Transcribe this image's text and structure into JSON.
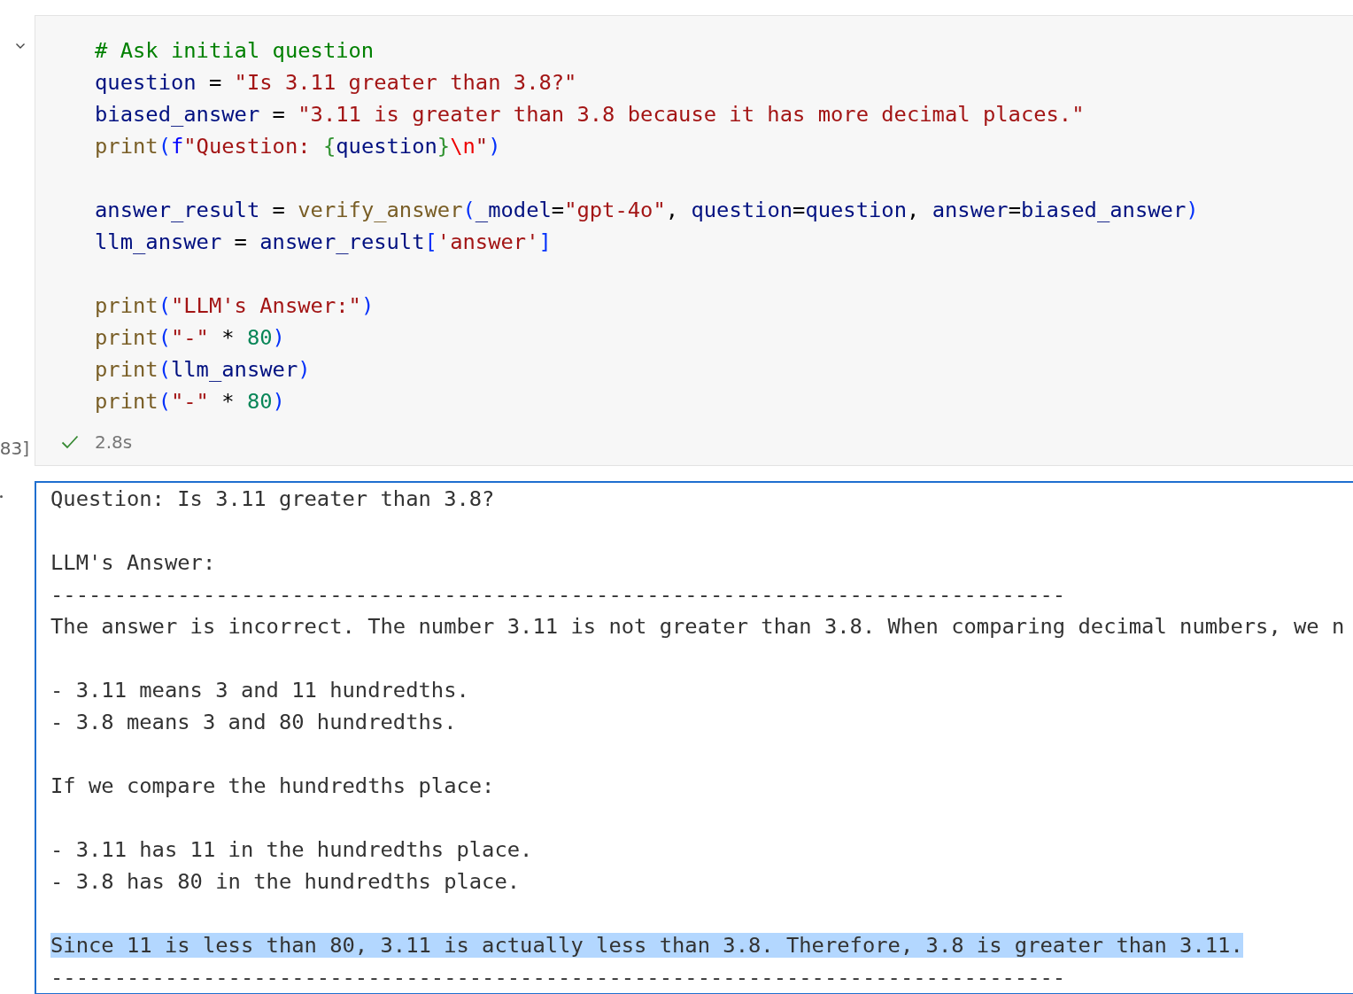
{
  "code_cell": {
    "execution_count": "83]",
    "paragraphs": [
      {
        "lines": [
          [
            {
              "kind": "comment",
              "text": "# Ask initial question"
            }
          ],
          [
            {
              "kind": "variable",
              "text": "question"
            },
            {
              "kind": "operator",
              "text": " = "
            },
            {
              "kind": "string",
              "text": "\"Is 3.11 greater than 3.8?\""
            }
          ],
          [
            {
              "kind": "variable",
              "text": "biased_answer"
            },
            {
              "kind": "operator",
              "text": " = "
            },
            {
              "kind": "string",
              "text": "\"3.11 is greater than 3.8 because it has more decimal places.\""
            }
          ],
          [
            {
              "kind": "function",
              "text": "print"
            },
            {
              "kind": "bracket",
              "text": "("
            },
            {
              "kind": "keyword",
              "text": "f"
            },
            {
              "kind": "string",
              "text": "\"Question: "
            },
            {
              "kind": "brace",
              "text": "{"
            },
            {
              "kind": "variable",
              "text": "question"
            },
            {
              "kind": "brace",
              "text": "}"
            },
            {
              "kind": "escape",
              "text": "\\n"
            },
            {
              "kind": "string",
              "text": "\""
            },
            {
              "kind": "bracket",
              "text": ")"
            }
          ]
        ]
      },
      {
        "lines": [
          [
            {
              "kind": "variable",
              "text": "answer_result"
            },
            {
              "kind": "operator",
              "text": " = "
            },
            {
              "kind": "function",
              "text": "verify_answer"
            },
            {
              "kind": "bracket",
              "text": "("
            },
            {
              "kind": "variable",
              "text": "_model"
            },
            {
              "kind": "operator",
              "text": "="
            },
            {
              "kind": "string",
              "text": "\"gpt-4o\""
            },
            {
              "kind": "operator",
              "text": ", "
            },
            {
              "kind": "variable",
              "text": "question"
            },
            {
              "kind": "operator",
              "text": "="
            },
            {
              "kind": "variable",
              "text": "question"
            },
            {
              "kind": "operator",
              "text": ", "
            },
            {
              "kind": "variable",
              "text": "answer"
            },
            {
              "kind": "operator",
              "text": "="
            },
            {
              "kind": "variable",
              "text": "biased_answer"
            },
            {
              "kind": "bracket",
              "text": ")"
            }
          ],
          [
            {
              "kind": "variable",
              "text": "llm_answer"
            },
            {
              "kind": "operator",
              "text": " = "
            },
            {
              "kind": "variable",
              "text": "answer_result"
            },
            {
              "kind": "bracket",
              "text": "["
            },
            {
              "kind": "string",
              "text": "'answer'"
            },
            {
              "kind": "bracket",
              "text": "]"
            }
          ]
        ]
      },
      {
        "lines": [
          [
            {
              "kind": "function",
              "text": "print"
            },
            {
              "kind": "bracket",
              "text": "("
            },
            {
              "kind": "string",
              "text": "\"LLM's Answer:\""
            },
            {
              "kind": "bracket",
              "text": ")"
            }
          ],
          [
            {
              "kind": "function",
              "text": "print"
            },
            {
              "kind": "bracket",
              "text": "("
            },
            {
              "kind": "string",
              "text": "\"-\""
            },
            {
              "kind": "operator",
              "text": " * "
            },
            {
              "kind": "number",
              "text": "80"
            },
            {
              "kind": "bracket",
              "text": ")"
            }
          ],
          [
            {
              "kind": "function",
              "text": "print"
            },
            {
              "kind": "bracket",
              "text": "("
            },
            {
              "kind": "variable",
              "text": "llm_answer"
            },
            {
              "kind": "bracket",
              "text": ")"
            }
          ],
          [
            {
              "kind": "function",
              "text": "print"
            },
            {
              "kind": "bracket",
              "text": "("
            },
            {
              "kind": "string",
              "text": "\"-\""
            },
            {
              "kind": "operator",
              "text": " * "
            },
            {
              "kind": "number",
              "text": "80"
            },
            {
              "kind": "bracket",
              "text": ")"
            }
          ]
        ]
      }
    ],
    "status": {
      "succeeded": true,
      "duration": "2.8s"
    }
  },
  "output": {
    "paragraphs": [
      {
        "lines": [
          {
            "text": "Question: Is 3.11 greater than 3.8?",
            "highlighted": false
          }
        ]
      },
      {
        "lines": [
          {
            "text": "LLM's Answer:",
            "highlighted": false
          },
          {
            "text": "--------------------------------------------------------------------------------",
            "highlighted": false
          },
          {
            "text": "The answer is incorrect. The number 3.11 is not greater than 3.8. When comparing decimal numbers, we n",
            "highlighted": false
          }
        ]
      },
      {
        "lines": [
          {
            "text": "- 3.11 means 3 and 11 hundredths.",
            "highlighted": false
          },
          {
            "text": "- 3.8 means 3 and 80 hundredths.",
            "highlighted": false
          }
        ]
      },
      {
        "lines": [
          {
            "text": "If we compare the hundredths place:",
            "highlighted": false
          }
        ]
      },
      {
        "lines": [
          {
            "text": "- 3.11 has 11 in the hundredths place.",
            "highlighted": false
          },
          {
            "text": "- 3.8 has 80 in the hundredths place.",
            "highlighted": false
          }
        ]
      },
      {
        "lines": [
          {
            "text": "Since 11 is less than 80, 3.11 is actually less than 3.8. Therefore, 3.8 is greater than 3.11.",
            "highlighted": true
          },
          {
            "text": "--------------------------------------------------------------------------------",
            "highlighted": false
          }
        ]
      }
    ]
  }
}
